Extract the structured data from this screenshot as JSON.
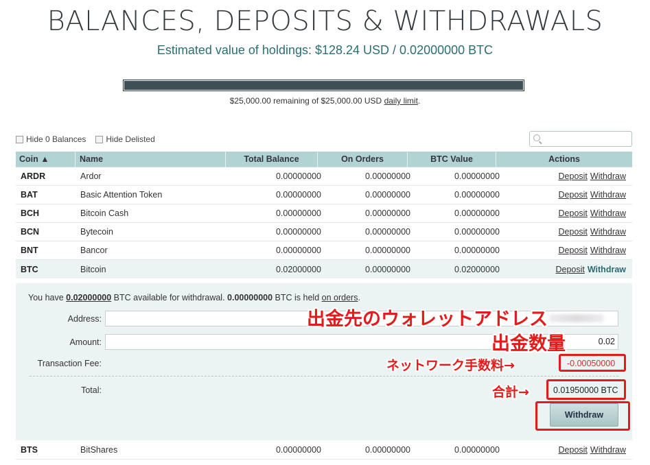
{
  "header": {
    "title": "BALANCES, DEPOSITS & WITHDRAWALS",
    "estimate": "Estimated value of holdings: $128.24 USD / 0.02000000 BTC"
  },
  "limit": {
    "fill_fraction": 1.0,
    "text_before": "$25,000.00 remaining of $25,000.00 USD ",
    "link": "daily limit",
    "text_after": "."
  },
  "filters": {
    "hide_zero": "Hide 0 Balances",
    "hide_delisted": "Hide Delisted"
  },
  "search": {
    "placeholder": ""
  },
  "table": {
    "headers": {
      "coin": "Coin ▲",
      "name": "Name",
      "total": "Total Balance",
      "orders": "On Orders",
      "btc": "BTC Value",
      "actions": "Actions"
    },
    "rows": [
      {
        "sym": "ARDR",
        "name": "Ardor",
        "total": "0.00000000",
        "orders": "0.00000000",
        "btc": "0.00000000",
        "deposit": "Deposit",
        "withdraw": "Withdraw"
      },
      {
        "sym": "BAT",
        "name": "Basic Attention Token",
        "total": "0.00000000",
        "orders": "0.00000000",
        "btc": "0.00000000",
        "deposit": "Deposit",
        "withdraw": "Withdraw"
      },
      {
        "sym": "BCH",
        "name": "Bitcoin Cash",
        "total": "0.00000000",
        "orders": "0.00000000",
        "btc": "0.00000000",
        "deposit": "Deposit",
        "withdraw": "Withdraw"
      },
      {
        "sym": "BCN",
        "name": "Bytecoin",
        "total": "0.00000000",
        "orders": "0.00000000",
        "btc": "0.00000000",
        "deposit": "Deposit",
        "withdraw": "Withdraw"
      },
      {
        "sym": "BNT",
        "name": "Bancor",
        "total": "0.00000000",
        "orders": "0.00000000",
        "btc": "0.00000000",
        "deposit": "Deposit",
        "withdraw": "Withdraw"
      },
      {
        "sym": "BTC",
        "name": "Bitcoin",
        "total": "0.02000000",
        "orders": "0.00000000",
        "btc": "0.02000000",
        "deposit": "Deposit",
        "withdraw": "Withdraw"
      },
      {
        "sym": "BTS",
        "name": "BitShares",
        "total": "0.00000000",
        "orders": "0.00000000",
        "btc": "0.00000000",
        "deposit": "Deposit",
        "withdraw": "Withdraw"
      }
    ]
  },
  "withdraw_panel": {
    "info_you_have": "You have ",
    "info_available": "0.02000000",
    "info_mid": " BTC available for withdrawal. ",
    "info_held": "0.00000000",
    "info_held_text": " BTC is held ",
    "info_link": "on orders",
    "info_end": ".",
    "address_label": "Address:",
    "address_value": "",
    "amount_label": "Amount:",
    "amount_value": "0.02",
    "fee_label": "Transaction Fee:",
    "fee_value": "-0.00050000",
    "total_label": "Total:",
    "total_value": "0.01950000 BTC",
    "button": "Withdraw"
  },
  "annotations": {
    "address": "出金先のウォレットアドレス",
    "amount": "出金数量",
    "fee": "ネットワーク手数料→",
    "total": "合計→",
    "color": "#e41b1b"
  }
}
